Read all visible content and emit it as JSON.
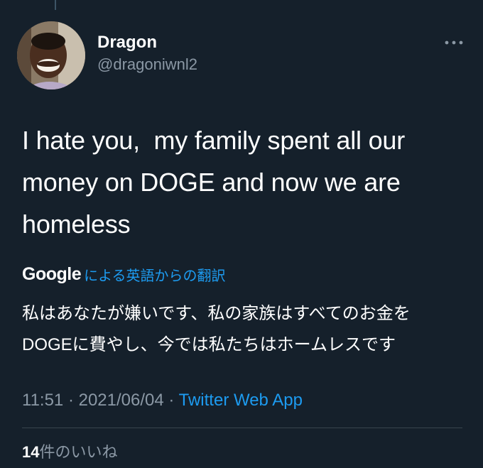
{
  "author": {
    "display_name": "Dragon",
    "handle": "@dragoniwnl2",
    "avatar_icon": "profile-photo"
  },
  "more_icon": "more-horizontal-icon",
  "tweet": {
    "text": "I hate you,  my family spent all our\nmoney on DOGE and now we are\nhomeless"
  },
  "translation": {
    "provider": "Google",
    "label": "による英語からの翻訳",
    "text": "私はあなたが嫌いです、私の家族はすべてのお金を\nDOGEに費やし、今では私たちはホームレスです"
  },
  "meta": {
    "time": "11:51",
    "date": "2021/06/04",
    "separator": " · ",
    "source": "Twitter Web App"
  },
  "likes": {
    "count": "14",
    "label": "件のいいね"
  },
  "colors": {
    "background": "#15202b",
    "link": "#1d9bf0",
    "secondary_text": "#8b98a5",
    "divider": "#38444d"
  }
}
